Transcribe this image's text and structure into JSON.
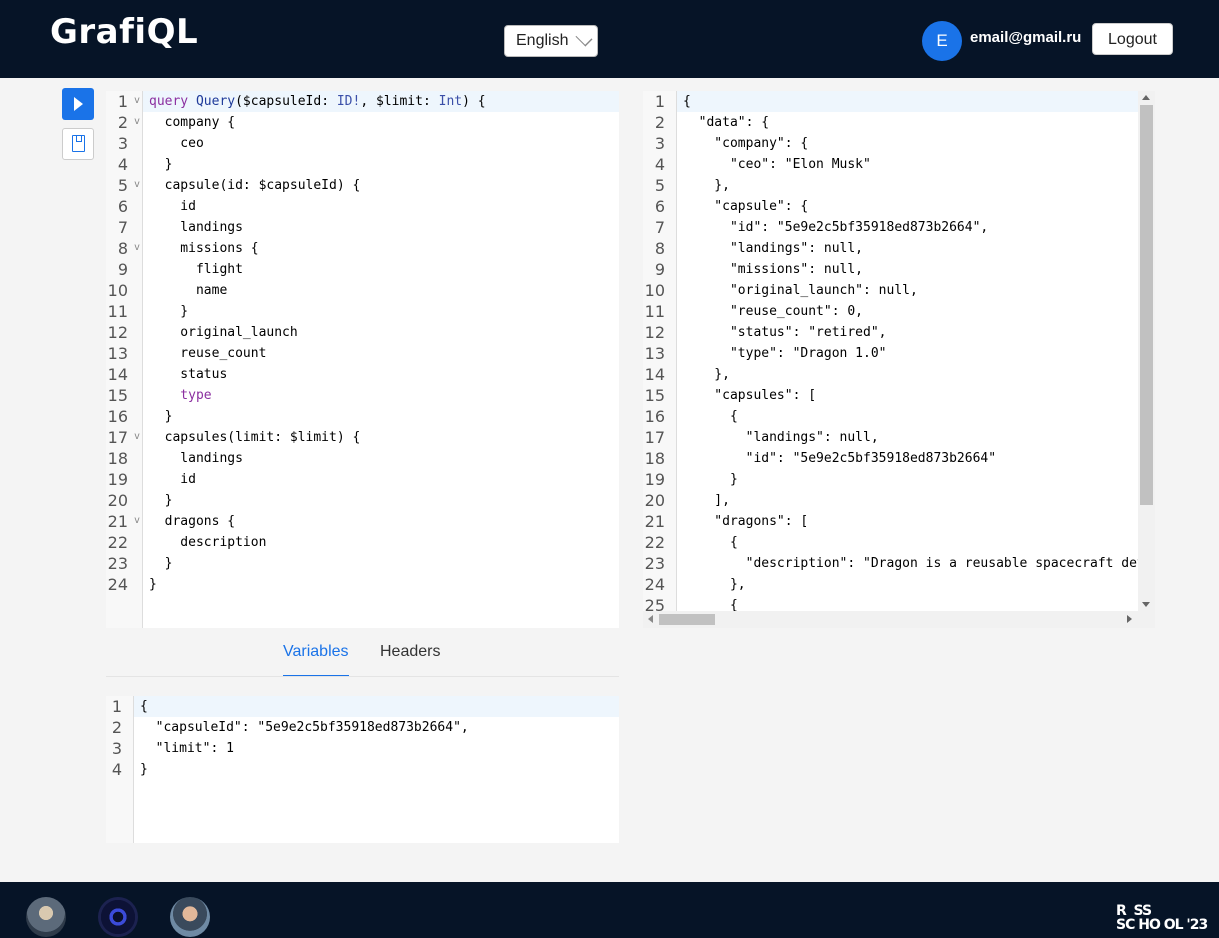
{
  "header": {
    "logo": "GrafiQL",
    "language": "English",
    "avatar_letter": "E",
    "email": "email@gmail.ru",
    "logout_label": "Logout"
  },
  "query_lines": [
    "query Query($capsuleId: ID!, $limit: Int) {",
    "  company {",
    "    ceo",
    "  }",
    "  capsule(id: $capsuleId) {",
    "    id",
    "    landings",
    "    missions {",
    "      flight",
    "      name",
    "    }",
    "    original_launch",
    "    reuse_count",
    "    status",
    "    type",
    "  }",
    "  capsules(limit: $limit) {",
    "    landings",
    "    id",
    "  }",
    "  dragons {",
    "    description",
    "  }",
    "}"
  ],
  "result_lines": [
    "{",
    "  \"data\": {",
    "    \"company\": {",
    "      \"ceo\": \"Elon Musk\"",
    "    },",
    "    \"capsule\": {",
    "      \"id\": \"5e9e2c5bf35918ed873b2664\",",
    "      \"landings\": null,",
    "      \"missions\": null,",
    "      \"original_launch\": null,",
    "      \"reuse_count\": 0,",
    "      \"status\": \"retired\",",
    "      \"type\": \"Dragon 1.0\"",
    "    },",
    "    \"capsules\": [",
    "      {",
    "        \"landings\": null,",
    "        \"id\": \"5e9e2c5bf35918ed873b2664\"",
    "      }",
    "    ],",
    "    \"dragons\": [",
    "      {",
    "        \"description\": \"Dragon is a reusable spacecraft devel",
    "      },",
    "      {"
  ],
  "tabs": {
    "variables": "Variables",
    "headers": "Headers"
  },
  "variables_lines": [
    "{",
    "  \"capsuleId\": \"5e9e2c5bf35918ed873b2664\",",
    "  \"limit\": 1",
    "}"
  ],
  "footer": {
    "school_logo_line1": "R  SS",
    "school_logo_line2": "SC HO OL '23"
  }
}
